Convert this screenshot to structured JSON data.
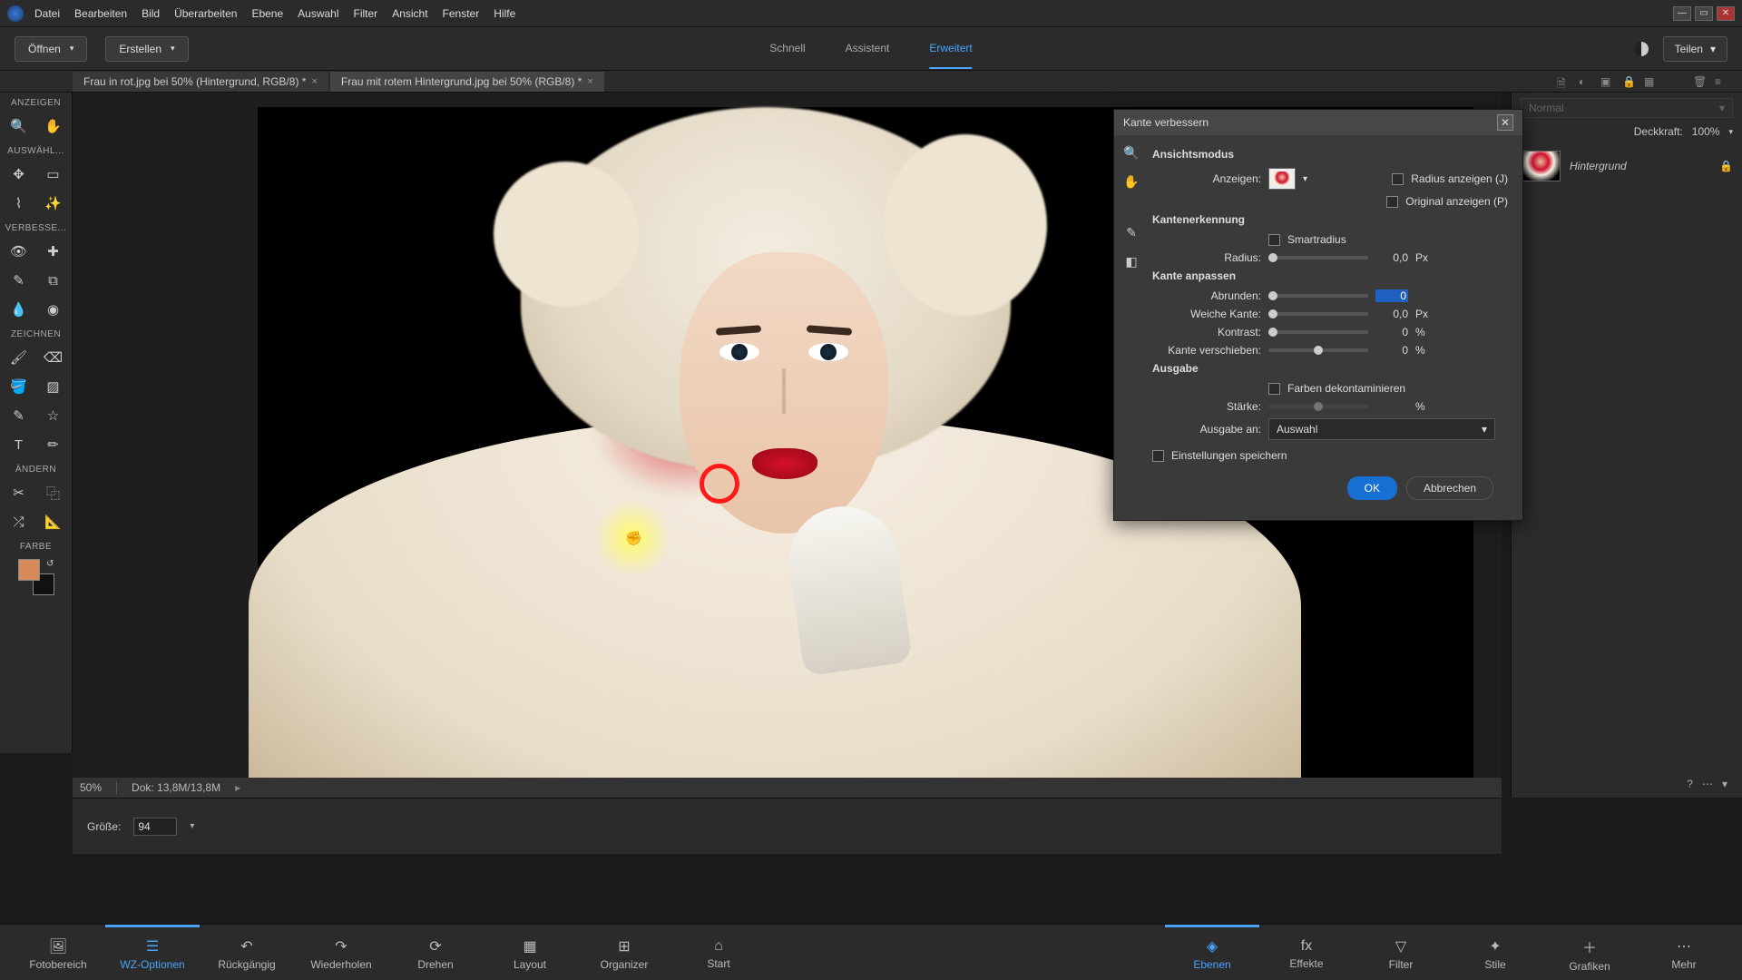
{
  "menu": {
    "items": [
      "Datei",
      "Bearbeiten",
      "Bild",
      "Überarbeiten",
      "Ebene",
      "Auswahl",
      "Filter",
      "Ansicht",
      "Fenster",
      "Hilfe"
    ]
  },
  "mode_bar": {
    "open": "Öffnen",
    "create": "Erstellen",
    "tabs": {
      "schnell": "Schnell",
      "assistent": "Assistent",
      "erweitert": "Erweitert"
    },
    "share": "Teilen"
  },
  "doc_tabs": [
    "Frau in rot.jpg bei 50% (Hintergrund, RGB/8) *",
    "Frau mit rotem Hintergrund.jpg bei 50% (RGB/8) *"
  ],
  "tool_sections": {
    "anzeigen": "ANZEIGEN",
    "auswahl": "AUSWÄHL...",
    "verbessern": "VERBESSE...",
    "zeichnen": "ZEICHNEN",
    "aendern": "ÄNDERN",
    "farbe": "FARBE"
  },
  "status": {
    "zoom": "50%",
    "doc": "Dok: 13,8M/13,8M"
  },
  "options": {
    "size_label": "Größe:",
    "size_value": "94"
  },
  "right_panel": {
    "blend_mode": "Normal",
    "opacity_label": "Deckkraft:",
    "opacity_value": "100%",
    "layer_name": "Hintergrund"
  },
  "dialog": {
    "title": "Kante verbessern",
    "section_view": "Ansichtsmodus",
    "view_label": "Anzeigen:",
    "show_radius": "Radius anzeigen (J)",
    "show_original": "Original anzeigen (P)",
    "section_edge": "Kantenerkennung",
    "smart_radius": "Smartradius",
    "radius_label": "Radius:",
    "radius_value": "0,0",
    "px": "Px",
    "section_adjust": "Kante anpassen",
    "smooth_label": "Abrunden:",
    "smooth_value": "0",
    "feather_label": "Weiche Kante:",
    "feather_value": "0,0",
    "contrast_label": "Kontrast:",
    "contrast_value": "0",
    "pct": "%",
    "shift_label": "Kante verschieben:",
    "shift_value": "0",
    "section_output": "Ausgabe",
    "decontaminate": "Farben dekontaminieren",
    "amount_label": "Stärke:",
    "output_to_label": "Ausgabe an:",
    "output_to_value": "Auswahl",
    "remember": "Einstellungen speichern",
    "ok": "OK",
    "cancel": "Abbrechen"
  },
  "bottom": {
    "left": [
      {
        "k": "fotobereich",
        "l": "Fotobereich"
      },
      {
        "k": "wz",
        "l": "WZ-Optionen"
      },
      {
        "k": "undo",
        "l": "Rückgängig"
      },
      {
        "k": "redo",
        "l": "Wiederholen"
      },
      {
        "k": "drehen",
        "l": "Drehen"
      },
      {
        "k": "layout",
        "l": "Layout"
      },
      {
        "k": "organizer",
        "l": "Organizer"
      },
      {
        "k": "start",
        "l": "Start"
      }
    ],
    "right": [
      {
        "k": "ebenen",
        "l": "Ebenen"
      },
      {
        "k": "effekte",
        "l": "Effekte"
      },
      {
        "k": "filter",
        "l": "Filter"
      },
      {
        "k": "stile",
        "l": "Stile"
      },
      {
        "k": "grafiken",
        "l": "Grafiken"
      },
      {
        "k": "mehr",
        "l": "Mehr"
      }
    ]
  }
}
